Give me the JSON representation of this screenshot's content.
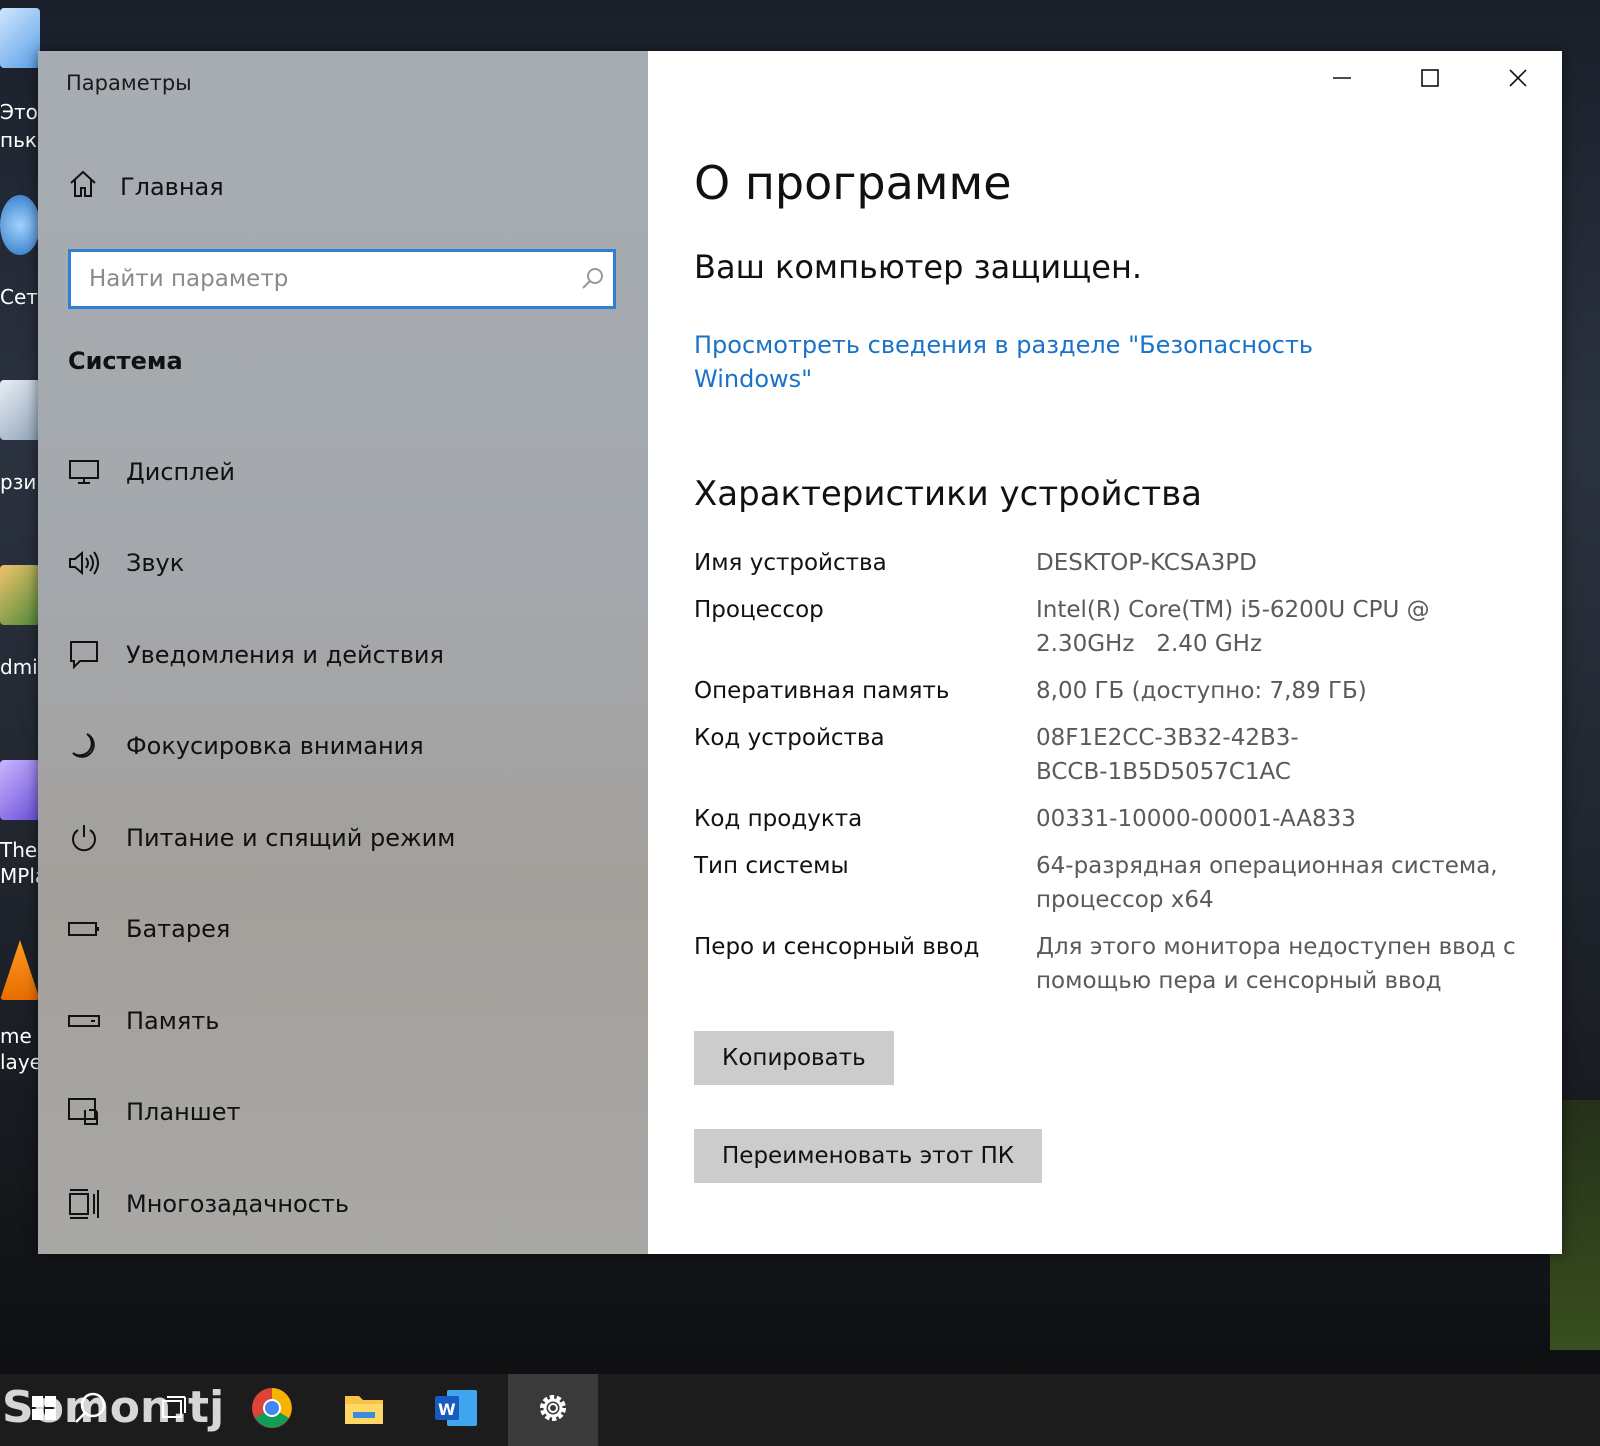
{
  "window": {
    "title": "Параметры"
  },
  "sidebar": {
    "home_label": "Главная",
    "search_placeholder": "Найти параметр",
    "section_title": "Система",
    "items": [
      {
        "label": "Дисплей",
        "icon": "display-icon"
      },
      {
        "label": "Звук",
        "icon": "speaker-icon"
      },
      {
        "label": "Уведомления и действия",
        "icon": "notification-icon"
      },
      {
        "label": "Фокусировка внимания",
        "icon": "moon-icon"
      },
      {
        "label": "Питание и спящий режим",
        "icon": "power-icon"
      },
      {
        "label": "Батарея",
        "icon": "battery-icon"
      },
      {
        "label": "Память",
        "icon": "storage-icon"
      },
      {
        "label": "Планшет",
        "icon": "tablet-icon"
      },
      {
        "label": "Многозадачность",
        "icon": "multitasking-icon"
      }
    ]
  },
  "main": {
    "title": "О программе",
    "protected_text": "Ваш компьютер защищен.",
    "security_link": "Просмотреть сведения в разделе \"Безопасность Windows\"",
    "device_specs_title": "Характеристики устройства",
    "specs": [
      {
        "key": "Имя устройства",
        "value": "DESKTOP-KCSA3PD"
      },
      {
        "key": "Процессор",
        "value": "Intel(R) Core(TM) i5-6200U CPU @ 2.30GHz   2.40 GHz"
      },
      {
        "key": "Оперативная память",
        "value": "8,00 ГБ (доступно: 7,89 ГБ)"
      },
      {
        "key": "Код устройства",
        "value": "08F1E2CC-3B32-42B3-BCCB-1B5D5057C1AC"
      },
      {
        "key": "Код продукта",
        "value": "00331-10000-00001-AA833"
      },
      {
        "key": "Тип системы",
        "value": "64-разрядная операционная система, процессор x64"
      },
      {
        "key": "Перо и сенсорный ввод",
        "value": "Для этого монитора недоступен ввод с помощью пера и сенсорный ввод"
      }
    ],
    "copy_button": "Копировать",
    "rename_button": "Переименовать этот ПК"
  },
  "desktop": {
    "labels": [
      "Этот",
      "пьк",
      "Сеть",
      "рзи",
      "dmi",
      "The",
      "MPla",
      "me",
      "laye"
    ]
  },
  "taskbar": {
    "watermark": "Somon.tj",
    "apps": [
      "start-icon",
      "search-icon",
      "task-view-icon",
      "chrome-icon",
      "file-explorer-icon",
      "word-icon",
      "settings-gear-icon"
    ]
  }
}
